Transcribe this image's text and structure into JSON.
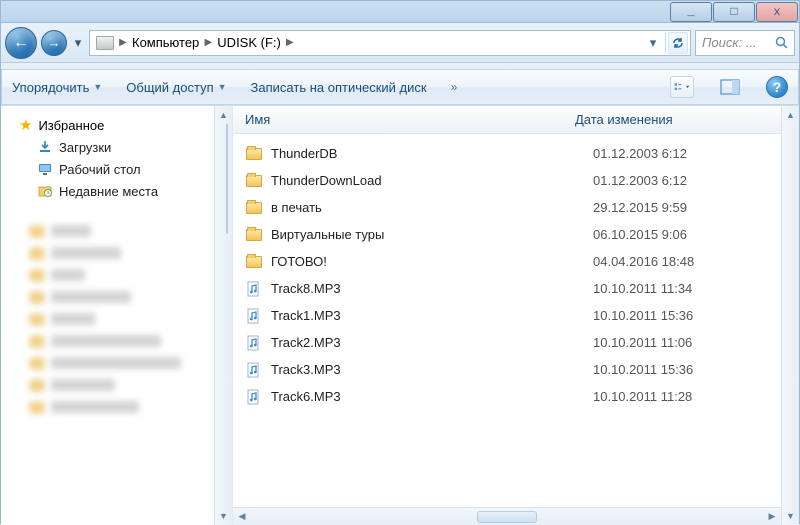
{
  "window_controls": {
    "min": "_",
    "max": "□",
    "close": "x"
  },
  "breadcrumb": [
    {
      "label": "Компьютер"
    },
    {
      "label": "UDISK (F:)"
    }
  ],
  "search": {
    "placeholder": "Поиск: ..."
  },
  "toolbar": {
    "organize": "Упорядочить",
    "share": "Общий доступ",
    "burn": "Записать на оптический диск",
    "overflow": "»"
  },
  "sidebar": {
    "favorites_header": "Избранное",
    "favorites": [
      {
        "label": "Загрузки",
        "icon": "downloads"
      },
      {
        "label": "Рабочий стол",
        "icon": "desktop"
      },
      {
        "label": "Недавние места",
        "icon": "recent"
      }
    ],
    "blurred_count": 9
  },
  "columns": {
    "name": "Имя",
    "date": "Дата изменения"
  },
  "items": [
    {
      "type": "folder",
      "name": "ThunderDB",
      "date": "01.12.2003 6:12"
    },
    {
      "type": "folder",
      "name": "ThunderDownLoad",
      "date": "01.12.2003 6:12"
    },
    {
      "type": "folder",
      "name": "в печать",
      "date": "29.12.2015 9:59"
    },
    {
      "type": "folder",
      "name": "Виртуальные туры",
      "date": "06.10.2015 9:06"
    },
    {
      "type": "folder",
      "name": "ГОТОВО!",
      "date": "04.04.2016 18:48"
    },
    {
      "type": "mp3",
      "name": "Track8.MP3",
      "date": "10.10.2011 11:34"
    },
    {
      "type": "mp3",
      "name": "Track1.MP3",
      "date": "10.10.2011 15:36"
    },
    {
      "type": "mp3",
      "name": "Track2.MP3",
      "date": "10.10.2011 11:06"
    },
    {
      "type": "mp3",
      "name": "Track3.MP3",
      "date": "10.10.2011 15:36"
    },
    {
      "type": "mp3",
      "name": "Track6.MP3",
      "date": "10.10.2011 11:28"
    }
  ]
}
